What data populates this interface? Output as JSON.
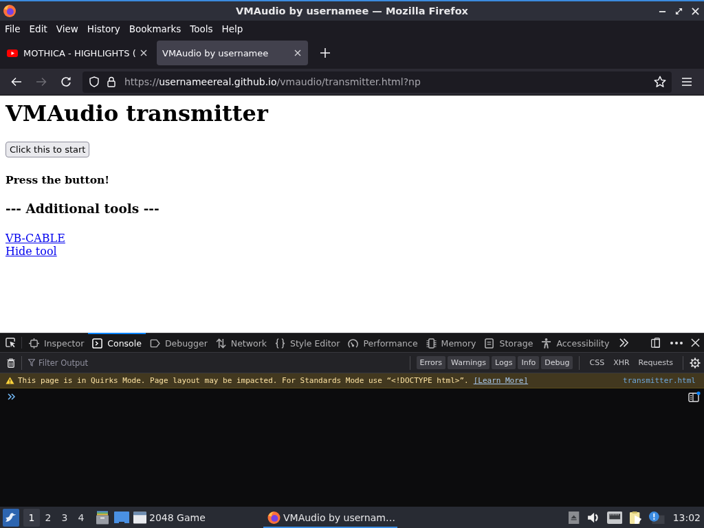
{
  "window": {
    "title": "VMAudio by usernamee — Mozilla Firefox"
  },
  "menu": [
    "File",
    "Edit",
    "View",
    "History",
    "Bookmarks",
    "Tools",
    "Help"
  ],
  "tabs": [
    {
      "title": "MOTHICA - HIGHLIGHTS (",
      "favicon": true,
      "selected": false
    },
    {
      "title": "VMAudio by usernamee",
      "favicon": false,
      "selected": true
    }
  ],
  "nav_buttons": [
    {
      "kind": "back",
      "disabled": false
    },
    {
      "kind": "forward",
      "disabled": true
    },
    {
      "kind": "reload",
      "disabled": false
    }
  ],
  "address_bar": {
    "scheme": "https://",
    "host": "usernameereal.github.io",
    "path": "/vmaudio/transmitter.html?np"
  },
  "page": {
    "heading": "VMAudio transmitter",
    "button": "Click this to start",
    "status": "Press the button!",
    "subheading": "--- Additional tools ---",
    "links": [
      "VB-CABLE",
      "Hide tool"
    ]
  },
  "devtools": {
    "tabs": [
      {
        "kind": "inspector",
        "label": "Inspector",
        "selected": false
      },
      {
        "kind": "console",
        "label": "Console",
        "selected": true
      },
      {
        "kind": "debugger",
        "label": "Debugger",
        "selected": false
      },
      {
        "kind": "network",
        "label": "Network",
        "selected": false
      },
      {
        "kind": "style-editor",
        "label": "Style Editor",
        "selected": false
      },
      {
        "kind": "performance",
        "label": "Performance",
        "selected": false
      },
      {
        "kind": "memory",
        "label": "Memory",
        "selected": false
      },
      {
        "kind": "storage",
        "label": "Storage",
        "selected": false
      },
      {
        "kind": "accessibility",
        "label": "Accessibility",
        "selected": false
      }
    ],
    "filter": {
      "placeholder": "Filter Output"
    },
    "level_filters": [
      {
        "label": "Errors",
        "checked": true
      },
      {
        "label": "Warnings",
        "checked": true
      },
      {
        "label": "Logs",
        "checked": true
      },
      {
        "label": "Info",
        "checked": true
      },
      {
        "label": "Debug",
        "checked": true
      }
    ],
    "type_filters": [
      {
        "label": "CSS",
        "checked": false
      },
      {
        "label": "XHR",
        "checked": false
      },
      {
        "label": "Requests",
        "checked": false
      }
    ],
    "messages": [
      {
        "kind": "warning",
        "text": "This page is in Quirks Mode. Page layout may be impacted. For Standards Mode use “<!DOCTYPE html>”.",
        "link": "[Learn More]",
        "source": "transmitter.html"
      }
    ]
  },
  "taskbar": {
    "workspaces": [
      {
        "label": "1",
        "selected": true
      },
      {
        "label": "2",
        "selected": false
      },
      {
        "label": "3",
        "selected": false
      },
      {
        "label": "4",
        "selected": false
      }
    ],
    "windows": [
      {
        "kind": "window",
        "title": "2048 Game",
        "active": false
      },
      {
        "kind": "firefox",
        "title": "VMAudio by usernam…",
        "active": true
      }
    ],
    "clock": "13:02"
  }
}
